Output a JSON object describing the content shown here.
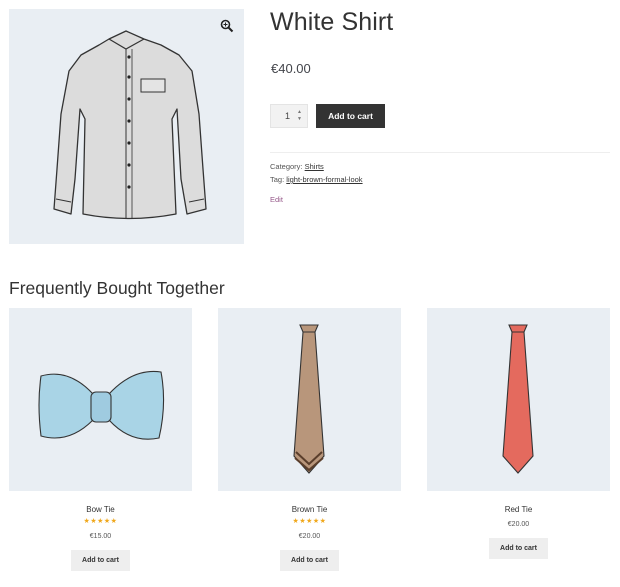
{
  "product": {
    "title": "White Shirt",
    "price": "€40.00",
    "quantity": "1",
    "add_to_cart": "Add to cart",
    "category_label": "Category:",
    "category_value": "Shirts",
    "tag_label": "Tag:",
    "tag_value": "light-brown-formal-look",
    "edit_label": "Edit",
    "image_icon": "zoom-icon"
  },
  "related": {
    "title": "Frequently Bought Together",
    "items": [
      {
        "name": "Bow Tie",
        "rating": 5,
        "price": "€15.00",
        "button": "Add to cart"
      },
      {
        "name": "Brown Tie",
        "rating": 5,
        "price": "€20.00",
        "button": "Add to cart"
      },
      {
        "name": "Red Tie",
        "price": "€20.00",
        "button": "Add to cart"
      }
    ]
  },
  "colors": {
    "image_bg": "#e9eef3",
    "button_dark": "#333333",
    "star": "#f0a81c",
    "edit_link": "#96588a",
    "bow_tie": "#a9d4e6",
    "brown_tie": "#b8967b",
    "red_tie": "#e46a5e"
  }
}
